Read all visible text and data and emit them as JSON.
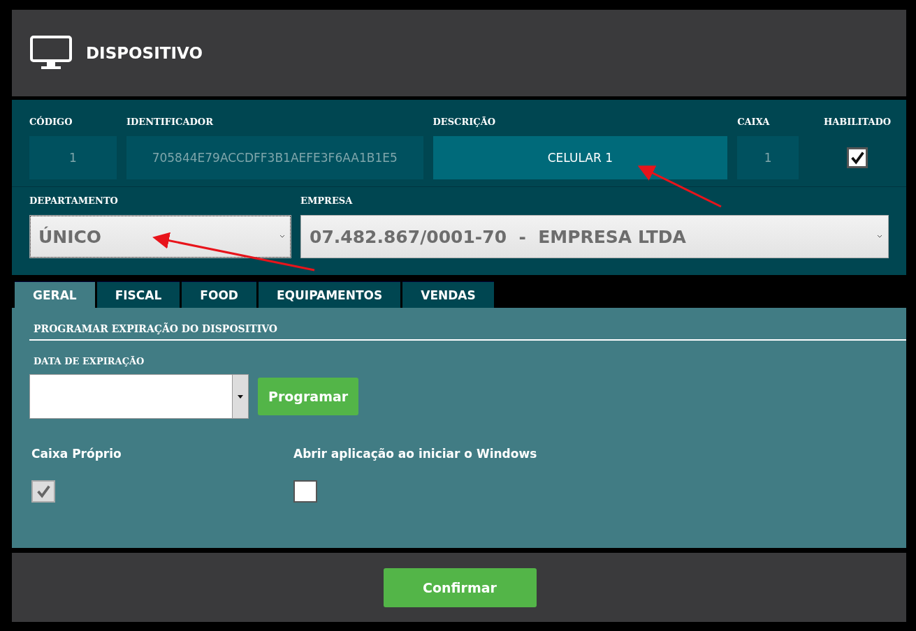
{
  "header": {
    "title": "DISPOSITIVO"
  },
  "fields": [
    {
      "label": "CÓDIGO",
      "value": "1",
      "kind": "readonly"
    },
    {
      "label": "IDENTIFICADOR",
      "value": "705844E79ACCDFF3B1AEFE3F6AA1B1E5",
      "kind": "readonly"
    },
    {
      "label": "DESCRIÇÃO",
      "value": "CELULAR 1",
      "kind": "editable"
    },
    {
      "label": "CAIXA",
      "value": "1",
      "kind": "readonly"
    },
    {
      "label": "HABILITADO",
      "checked": true,
      "kind": "checkbox"
    }
  ],
  "selects": [
    {
      "label": "DEPARTAMENTO",
      "value": "ÚNICO",
      "focused": true
    },
    {
      "label": "EMPRESA",
      "value": "07.482.867/0001-70  -  EMPRESA LTDA",
      "focused": false
    }
  ],
  "tabs": [
    {
      "label": "GERAL",
      "selected": true
    },
    {
      "label": "FISCAL",
      "selected": false
    },
    {
      "label": "FOOD",
      "selected": false
    },
    {
      "label": "EQUIPAMENTOS",
      "selected": false
    },
    {
      "label": "VENDAS",
      "selected": false
    }
  ],
  "section_title": "PROGRAMAR EXPIRAÇÃO DO DISPOSITIVO",
  "expiration": {
    "label": "DATA DE EXPIRAÇÃO",
    "button": "Programar"
  },
  "options": [
    {
      "label": "Caixa Próprio",
      "checked": true,
      "disabled": true
    },
    {
      "label": "Abrir aplicação ao iniciar o Windows",
      "checked": false,
      "disabled": false
    }
  ],
  "confirm_button": "Confirmar"
}
